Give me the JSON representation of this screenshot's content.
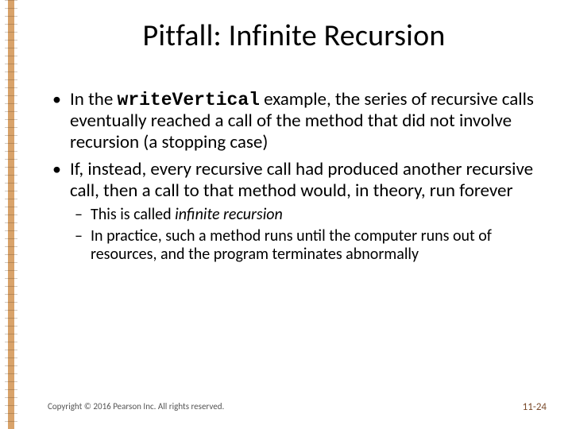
{
  "title": "Pitfall:  Infinite Recursion",
  "bullets": {
    "b1_pre": "In the ",
    "b1_code": "writeVertical",
    "b1_post": " example, the series of recursive calls eventually reached a call of the method that did not involve recursion (a stopping case)",
    "b2": "If, instead, every recursive call had produced another recursive call, then a call to that method would, in theory, run forever",
    "b2a_pre": "This is called ",
    "b2a_em": "infinite recursion",
    "b2b": "In practice, such a method runs until the computer runs out of resources, and the program terminates abnormally"
  },
  "footer": {
    "copyright": "Copyright © 2016 Pearson Inc. All rights reserved.",
    "page": "11-24"
  }
}
